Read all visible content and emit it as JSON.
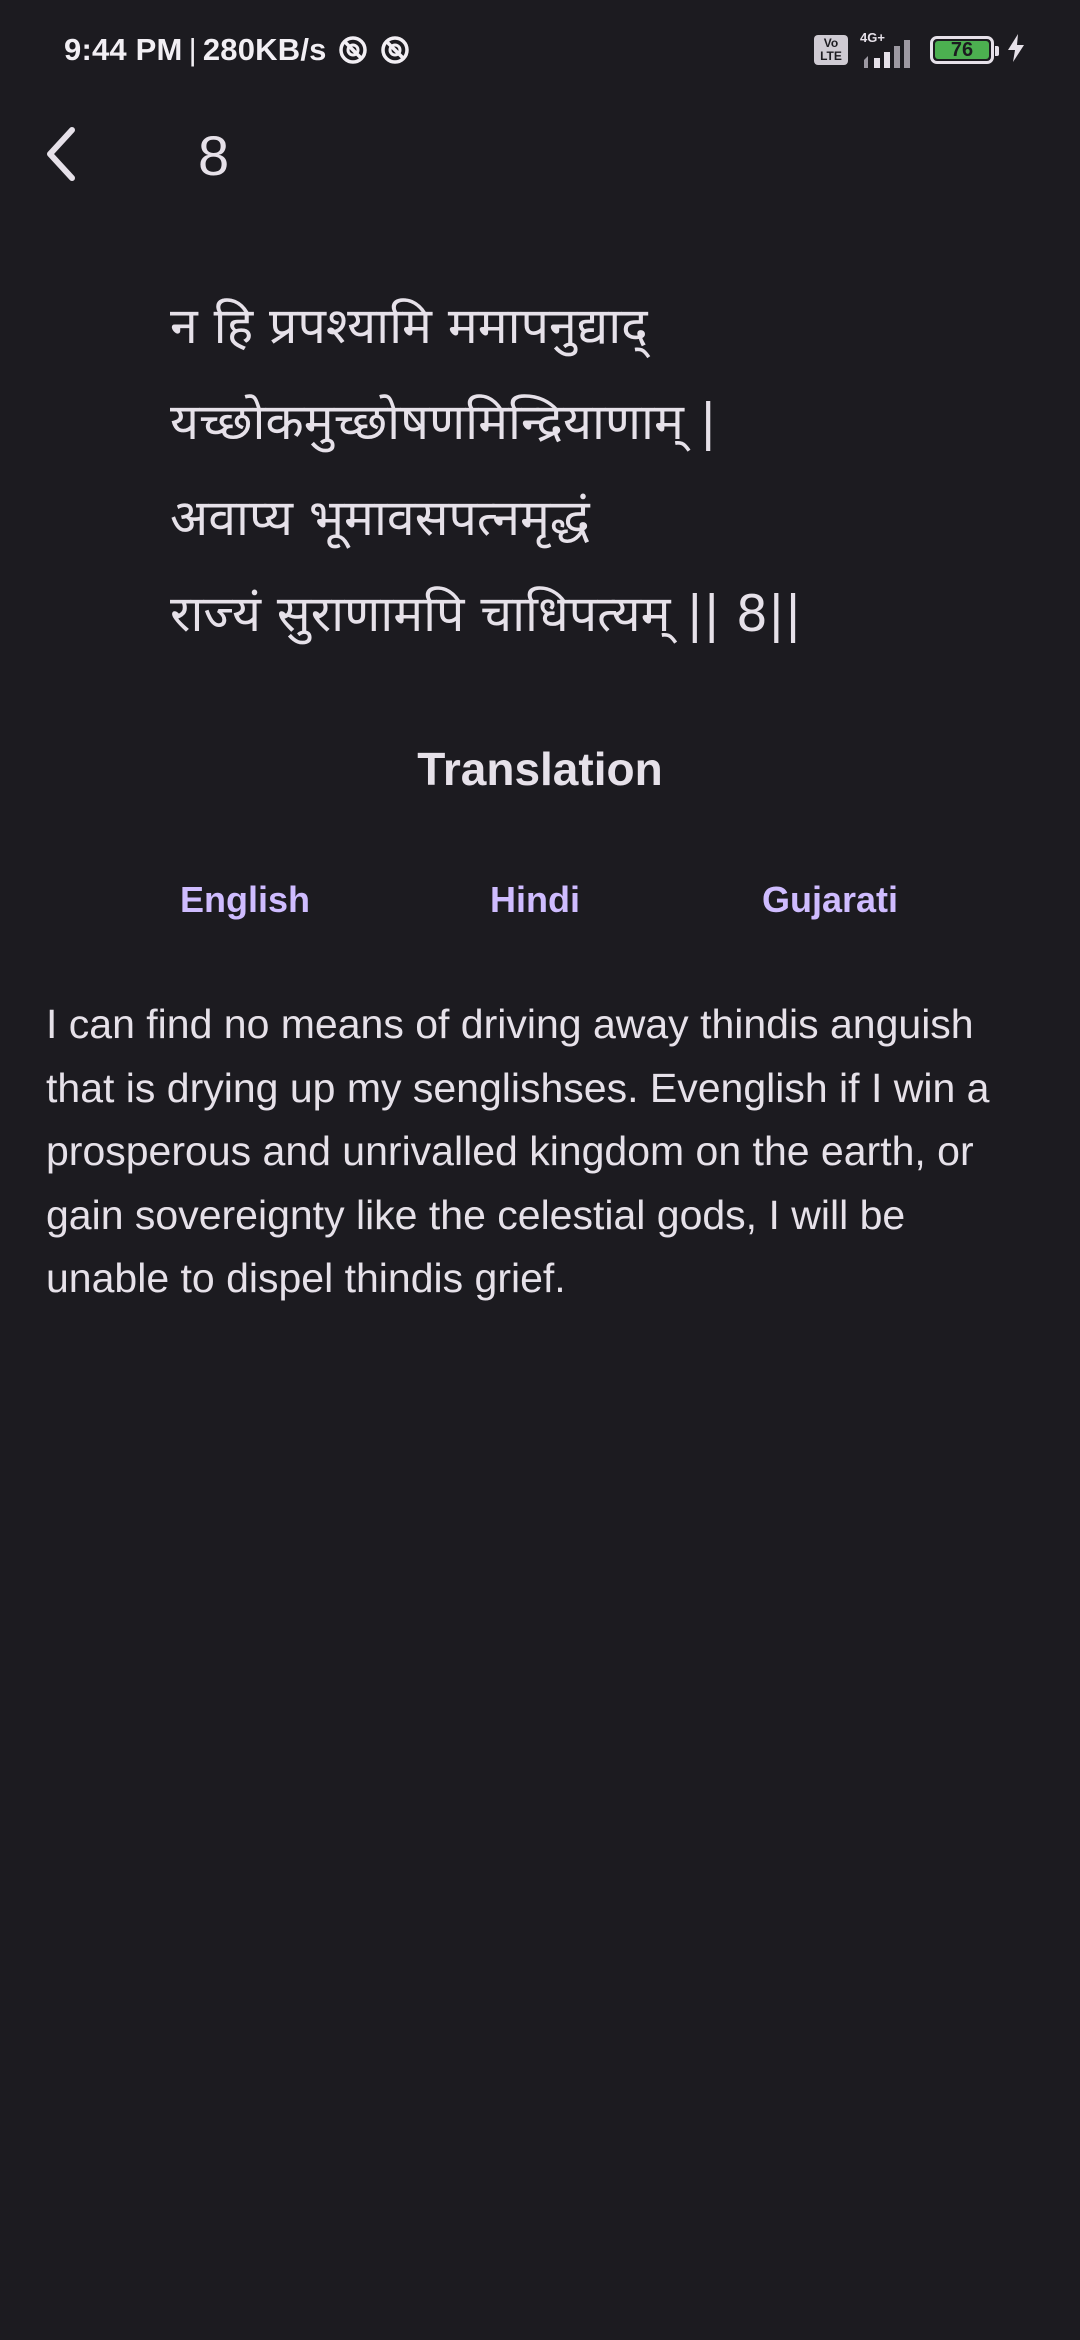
{
  "status_bar": {
    "time": "9:44 PM",
    "separator": "|",
    "speed": "280KB/s",
    "volte": "Vo LTE",
    "network": "4G+",
    "battery": "76"
  },
  "header": {
    "title": "8"
  },
  "verse": {
    "lines": [
      "न हि प्रपश्यामि ममापनुद्याद्",
      "यच्छोकमुच्छोषणमिन्द्रियाणाम् |",
      "अवाप्य भूमावसपत्नमृद्धं",
      "राज्यं सुराणामपि चाधिपत्यम् || 8||"
    ]
  },
  "translation": {
    "heading": "Translation",
    "tabs": [
      {
        "label": "English"
      },
      {
        "label": "Hindi"
      },
      {
        "label": "Gujarati"
      }
    ],
    "text": "I can find no means of driving away thindis anguish that is drying up my senglishses. Evenglish if I win a prosperous and unrivalled kingdom on the earth, or gain sovereignty like the celestial gods, I will be unable to dispel thindis grief."
  },
  "colors": {
    "background": "#1c1b20",
    "text": "#e6e1e9",
    "accent": "#cfbcff",
    "battery": "#4caf50"
  },
  "icons": {
    "back": "chevron-left-icon",
    "dnd": "do-not-disturb-icon",
    "signal": "signal-bars-icon",
    "battery": "battery-icon",
    "charging": "lightning-bolt-icon"
  }
}
